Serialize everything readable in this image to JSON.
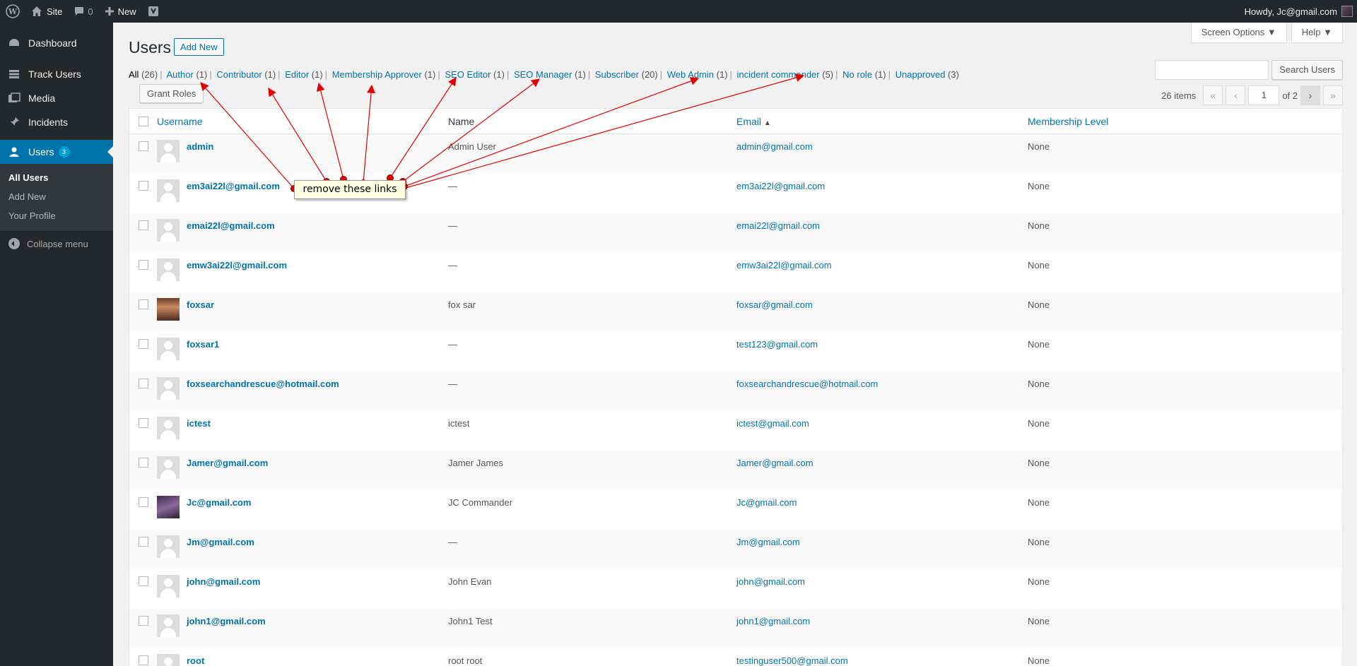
{
  "adminbar": {
    "site": "Site",
    "comments": "0",
    "new": "New",
    "howdy": "Howdy, Jc@gmail.com"
  },
  "sidebar": {
    "items": [
      {
        "label": "Dashboard",
        "icon": "dashboard-icon"
      },
      {
        "label": "Track Users",
        "icon": "table-icon"
      },
      {
        "label": "Media",
        "icon": "media-icon"
      },
      {
        "label": "Incidents",
        "icon": "pin-icon"
      },
      {
        "label": "Users",
        "icon": "users-icon",
        "badge": "3"
      }
    ],
    "submenu": [
      "All Users",
      "Add New",
      "Your Profile"
    ],
    "collapse": "Collapse menu"
  },
  "header": {
    "screen_options": "Screen Options ▼",
    "help": "Help ▼",
    "title": "Users",
    "add_new": "Add New"
  },
  "filters": [
    {
      "label": "All",
      "count": "(26)"
    },
    {
      "label": "Author",
      "count": "(1)"
    },
    {
      "label": "Contributor",
      "count": "(1)"
    },
    {
      "label": "Editor",
      "count": "(1)"
    },
    {
      "label": "Membership Approver",
      "count": "(1)"
    },
    {
      "label": "SEO Editor",
      "count": "(1)"
    },
    {
      "label": "SEO Manager",
      "count": "(1)"
    },
    {
      "label": "Subscriber",
      "count": "(20)"
    },
    {
      "label": "Web Admin",
      "count": "(1)"
    },
    {
      "label": "incident commander",
      "count": "(5)"
    },
    {
      "label": "No role",
      "count": "(1)"
    },
    {
      "label": "Unapproved",
      "count": "(3)"
    }
  ],
  "search": {
    "button": "Search Users",
    "value": ""
  },
  "grant_roles": "Grant Roles",
  "pagination": {
    "items": "26 items",
    "first": "«",
    "prev": "‹",
    "current": "1",
    "of": "of 2",
    "next": "›",
    "last": "»"
  },
  "table": {
    "columns": {
      "username": "Username",
      "name": "Name",
      "email": "Email",
      "sort_arrow": "▲",
      "level": "Membership Level"
    },
    "rows": [
      {
        "username": "admin",
        "name": "Admin User",
        "email": "admin@gmail.com",
        "level": "None"
      },
      {
        "username": "em3ai22l@gmail.com",
        "name": "—",
        "email": "em3ai22l@gmail.com",
        "level": "None"
      },
      {
        "username": "emai22l@gmail.com",
        "name": "—",
        "email": "emai22l@gmail.com",
        "level": "None"
      },
      {
        "username": "emw3ai22l@gmail.com",
        "name": "—",
        "email": "emw3ai22l@gmail.com",
        "level": "None"
      },
      {
        "username": "foxsar",
        "name": "fox sar",
        "email": "foxsar@gmail.com",
        "level": "None"
      },
      {
        "username": "foxsar1",
        "name": "—",
        "email": "test123@gmail.com",
        "level": "None"
      },
      {
        "username": "foxsearchandrescue@hotmail.com",
        "name": "—",
        "email": "foxsearchandrescue@hotmail.com",
        "level": "None"
      },
      {
        "username": "ictest",
        "name": "ictest",
        "email": "ictest@gmail.com",
        "level": "None"
      },
      {
        "username": "Jamer@gmail.com",
        "name": "Jamer James",
        "email": "Jamer@gmail.com",
        "level": "None"
      },
      {
        "username": "Jc@gmail.com",
        "name": "JC Commander",
        "email": "Jc@gmail.com",
        "level": "None"
      },
      {
        "username": "Jm@gmail.com",
        "name": "—",
        "email": "Jm@gmail.com",
        "level": "None"
      },
      {
        "username": "john@gmail.com",
        "name": "John Evan",
        "email": "john@gmail.com",
        "level": "None"
      },
      {
        "username": "john1@gmail.com",
        "name": "John1 Test",
        "email": "john1@gmail.com",
        "level": "None"
      },
      {
        "username": "root",
        "name": "root root",
        "email": "testinguser500@gmail.com",
        "level": "None"
      }
    ]
  },
  "annotation": {
    "text": "remove these links"
  },
  "colors": {
    "accent": "#0073aa",
    "adminbar": "#23282d",
    "annotation_arrow": "#e00000"
  }
}
